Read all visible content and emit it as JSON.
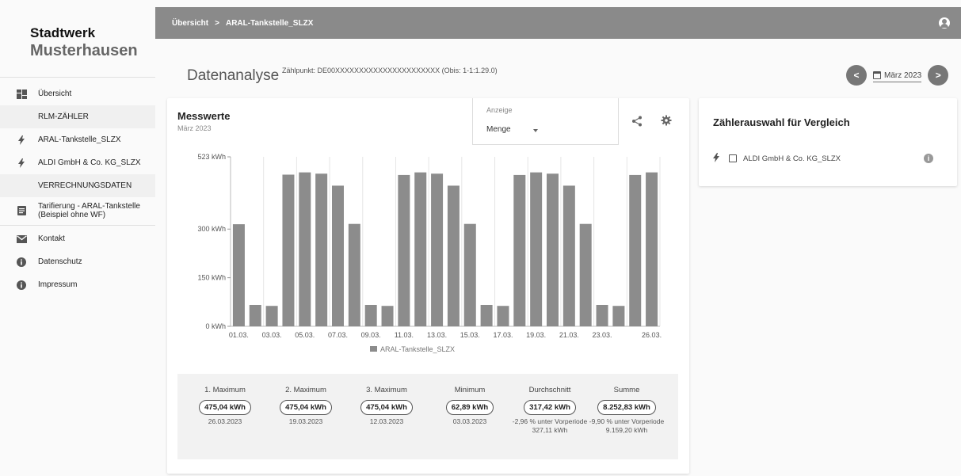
{
  "brand": {
    "line1": "Stadtwerk",
    "line2": "Musterhausen"
  },
  "sidebar": {
    "items": [
      {
        "label": "Übersicht",
        "icon": "dashboard-icon",
        "type": "link"
      },
      {
        "label": "RLM-ZÄHLER",
        "type": "section"
      },
      {
        "label": "ARAL-Tankstelle_SLZX",
        "icon": "lightning-icon",
        "type": "link"
      },
      {
        "label": "ALDI GmbH & Co. KG_SLZX",
        "icon": "lightning-icon",
        "type": "link"
      },
      {
        "label": "VERRECHNUNGSDATEN",
        "type": "section"
      },
      {
        "label": "Tarifierung - ARAL-Tankstelle (Beispiel ohne WF)",
        "icon": "document-icon",
        "type": "link"
      },
      {
        "label": "Kontakt",
        "icon": "mail-icon",
        "type": "link"
      },
      {
        "label": "Datenschutz",
        "icon": "info-icon",
        "type": "link"
      },
      {
        "label": "Impressum",
        "icon": "info-icon",
        "type": "link"
      }
    ]
  },
  "breadcrumb": {
    "home": "Übersicht",
    "separator": ">",
    "current": "ARAL-Tankstelle_SLZX"
  },
  "header": {
    "title": "Datenanalyse",
    "zaehlpunkt": "Zählpunkt: DE00XXXXXXXXXXXXXXXXXXXXXX (Obis: 1-1:1.29.0)",
    "date": "März 2023",
    "prev": "<",
    "next": ">"
  },
  "messwerte": {
    "title": "Messwerte",
    "subtitle": "März 2023",
    "anzeige_label": "Anzeige",
    "anzeige_value": "Menge"
  },
  "chart_data": {
    "type": "bar",
    "x_tick_labels": [
      "01.03.",
      "03.03.",
      "05.03.",
      "07.03.",
      "09.03.",
      "11.03.",
      "13.03.",
      "15.03.",
      "17.03.",
      "19.03.",
      "21.03.",
      "23.03.",
      "26.03."
    ],
    "y_tick_labels": [
      "0 kWh",
      "150 kWh",
      "300 kWh",
      "523 kWh"
    ],
    "ylim": [
      0,
      523
    ],
    "yticks": [
      0,
      150,
      300,
      523
    ],
    "grid": "vertical",
    "legend": "bottom",
    "color": "#8c8c8c",
    "series": [
      {
        "name": "ARAL-Tankstelle_SLZX",
        "categories": [
          "01.03.",
          "02.03.",
          "03.03.",
          "04.03.",
          "05.03.",
          "06.03.",
          "07.03.",
          "08.03.",
          "09.03.",
          "10.03.",
          "11.03.",
          "12.03.",
          "13.03.",
          "14.03.",
          "15.03.",
          "16.03.",
          "17.03.",
          "18.03.",
          "19.03.",
          "20.03.",
          "21.03.",
          "22.03.",
          "23.03.",
          "24.03.",
          "25.03.",
          "26.03."
        ],
        "values": [
          315,
          66,
          63,
          468,
          475,
          471,
          434,
          316,
          66,
          63,
          467,
          475,
          471,
          434,
          316,
          66,
          63,
          467,
          475,
          471,
          434,
          316,
          66,
          63,
          467,
          475
        ]
      }
    ]
  },
  "stats": [
    {
      "title": "1. Maximum",
      "value": "475,04 kWh",
      "sub": "26.03.2023"
    },
    {
      "title": "2. Maximum",
      "value": "475,04 kWh",
      "sub": "19.03.2023"
    },
    {
      "title": "3. Maximum",
      "value": "475,04 kWh",
      "sub": "12.03.2023"
    },
    {
      "title": "Minimum",
      "value": "62,89 kWh",
      "sub": "03.03.2023"
    },
    {
      "title": "Durchschnitt",
      "value": "317,42 kWh",
      "sub": "-2,96 % unter Vorperiode 327,11 kWh"
    },
    {
      "title": "Summe",
      "value": "8.252,83 kWh",
      "sub": "-9,90 % unter Vorperiode 9.159,20 kWh"
    }
  ],
  "compare": {
    "title": "Zählerauswahl für Vergleich",
    "item": "ALDI GmbH & Co. KG_SLZX"
  }
}
